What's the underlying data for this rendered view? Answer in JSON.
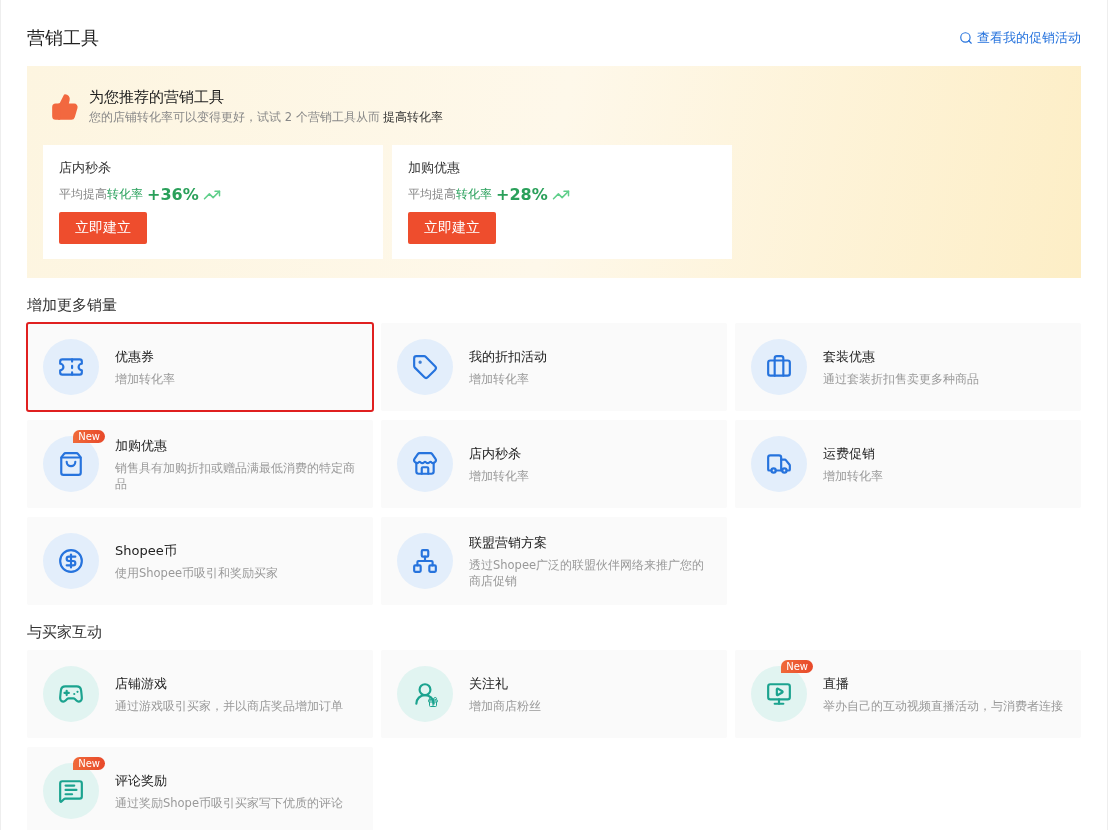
{
  "page_title": "营销工具",
  "header_link": "查看我的促销活动",
  "recommendation": {
    "title": "为您推荐的营销工具",
    "subtitle": "您的店铺转化率可以变得更好，试试 2 个营销工具从而 **提高转化率**",
    "cards": [
      {
        "title": "店内秒杀",
        "stat_label": "平均提高**转化率**",
        "stat_value": "+36%",
        "button": "立即建立"
      },
      {
        "title": "加购优惠",
        "stat_label": "平均提高**转化率**",
        "stat_value": "+28%",
        "button": "立即建立"
      }
    ]
  },
  "sections": [
    {
      "title": "增加更多销量",
      "tools": [
        {
          "kind": "voucher",
          "name": "优惠券",
          "description": "增加转化率",
          "highlighted": true
        },
        {
          "kind": "discount",
          "name": "我的折扣活动",
          "description": "增加转化率",
          "highlighted": false
        },
        {
          "kind": "bundle",
          "name": "套装优惠",
          "description": "通过套装折扣售卖更多种商品",
          "highlighted": false
        },
        {
          "kind": "addon",
          "name": "加购优惠",
          "description": "销售具有加购折扣或赠品满最低消费的特定商品",
          "badge": "New",
          "highlighted": false
        },
        {
          "kind": "flash",
          "name": "店内秒杀",
          "description": "增加转化率",
          "highlighted": false
        },
        {
          "kind": "shipping",
          "name": "运费促销",
          "description": "增加转化率",
          "highlighted": false
        },
        {
          "kind": "coin",
          "name": "Shopee币",
          "description": "使用Shopee币吸引和奖励买家",
          "highlighted": false
        },
        {
          "kind": "affiliate",
          "name": "联盟营销方案",
          "description": "透过Shopee广泛的联盟伙伴网络来推广您的商店促销",
          "highlighted": false
        }
      ]
    },
    {
      "title": "与买家互动",
      "tools": [
        {
          "kind": "game",
          "name": "店铺游戏",
          "description": "通过游戏吸引买家，并以商店奖品增加订单",
          "highlighted": false
        },
        {
          "kind": "follow",
          "name": "关注礼",
          "description": "增加商店粉丝",
          "highlighted": false
        },
        {
          "kind": "live",
          "name": "直播",
          "description": "举办自己的互动视频直播活动，与消费者连接",
          "badge": "New",
          "highlighted": false
        },
        {
          "kind": "review",
          "name": "评论奖励",
          "description": "通过奖励Shope币吸引买家写下优质的评论",
          "badge": "New",
          "highlighted": false
        }
      ]
    }
  ]
}
